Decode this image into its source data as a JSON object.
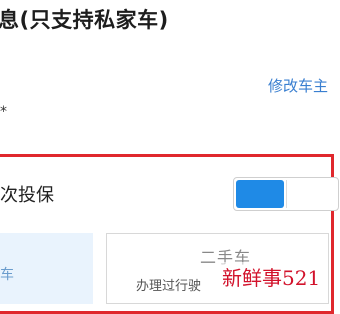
{
  "header": {
    "title": "息(只支持私家车)"
  },
  "owner": {
    "modify_link": "修改车主"
  },
  "form": {
    "required_mark": "*"
  },
  "first_insure": {
    "label": "次投保",
    "toggle_on": true
  },
  "vehicle_type": {
    "left_option_char": "车",
    "right_option": {
      "title": "二手车",
      "subtitle": "办理过行驶"
    }
  },
  "watermark": {
    "text": "新鲜事521"
  },
  "colors": {
    "link": "#3a7fd0",
    "toggle_active": "#1f8ae6",
    "highlight_border": "#e0282d",
    "option_selected_bg": "#e9f3fd"
  }
}
